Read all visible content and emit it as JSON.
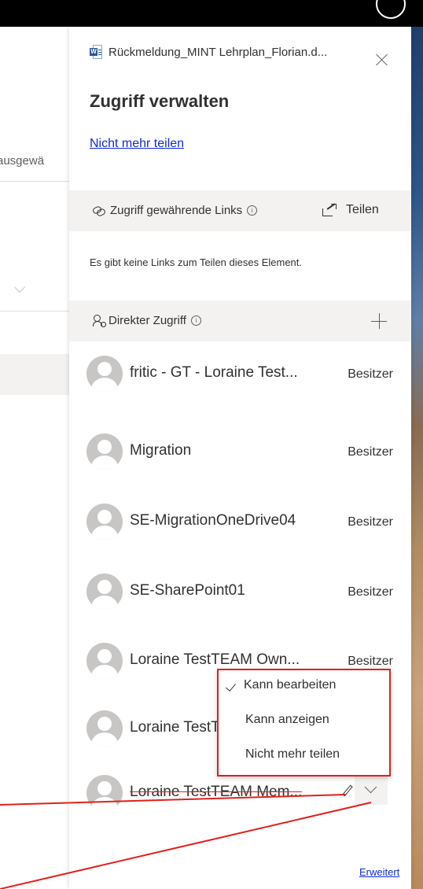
{
  "background": {
    "left_fragment": "ausgewä"
  },
  "panel": {
    "file_name": "Rückmeldung_MINT Lehrplan_Florian.d...",
    "title": "Zugriff verwalten",
    "stop_sharing_link": "Nicht mehr teilen",
    "links_section": {
      "label": "Zugriff gewährende Links",
      "share_label": "Teilen",
      "empty_text": "Es gibt keine Links zum Teilen dieses Element."
    },
    "direct_section": {
      "label": "Direkter Zugriff"
    },
    "people": [
      {
        "name": "fritic - GT - Loraine Test...",
        "role": "Besitzer"
      },
      {
        "name": "Migration",
        "role": "Besitzer"
      },
      {
        "name": "SE-MigrationOneDrive04",
        "role": "Besitzer"
      },
      {
        "name": "SE-SharePoint01",
        "role": "Besitzer"
      },
      {
        "name": "Loraine TestTEAM Own...",
        "role": "Besitzer"
      },
      {
        "name": "Loraine TestTEAM Mem...",
        "role": ""
      },
      {
        "name": "Loraine TestTEAM Mem...",
        "role": ""
      }
    ],
    "permission_menu": {
      "options": [
        "Kann bearbeiten",
        "Kann anzeigen",
        "Nicht mehr teilen"
      ],
      "selected": "Kann bearbeiten"
    },
    "advanced_link": "Erweitert"
  },
  "colors": {
    "link_blue": "#0f2bd6",
    "annotation_red": "#e0201c",
    "section_bg": "#f3f2f1",
    "word_blue": "#2b579a"
  },
  "icons": [
    "word-doc-icon",
    "close-icon",
    "link-icon",
    "info-icon",
    "share-icon",
    "people-icon",
    "plus-icon",
    "avatar-icon",
    "pencil-icon",
    "chevron-down-icon",
    "checkmark-icon"
  ]
}
